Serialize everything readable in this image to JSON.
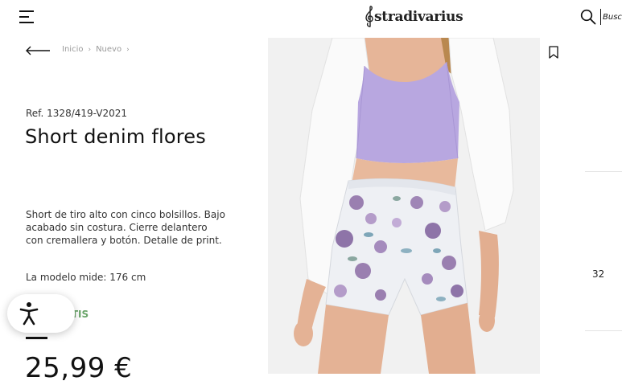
{
  "header": {
    "logo_text": "stradivarius",
    "search_placeholder": "Buscar"
  },
  "breadcrumb": {
    "items": [
      "Inicio",
      "Nuevo"
    ],
    "separator": "›"
  },
  "product": {
    "reference": "Ref. 1328/419-V2021",
    "name": "Short denim flores",
    "description": "Short de tiro alto con cinco bolsillos. Bajo acabado sin costura. Cierre delantero con cremallera y botón. Detalle de print.",
    "model_info": "La modelo mide: 176 cm",
    "shipping_text": "nda GRATIS",
    "price": "25,99 €"
  },
  "size_panel": {
    "selected_size": "32"
  },
  "colors": {
    "shipping_green": "#6aa56a",
    "top_lilac": "#b7a6df",
    "shirt_white": "#f7f7f7",
    "flower_purple": "#9a7fb0"
  },
  "icons": {
    "menu": "hamburger-menu-icon",
    "search": "search-icon",
    "back": "arrow-left-icon",
    "bookmark": "bookmark-icon",
    "accessibility": "accessibility-person-icon"
  }
}
